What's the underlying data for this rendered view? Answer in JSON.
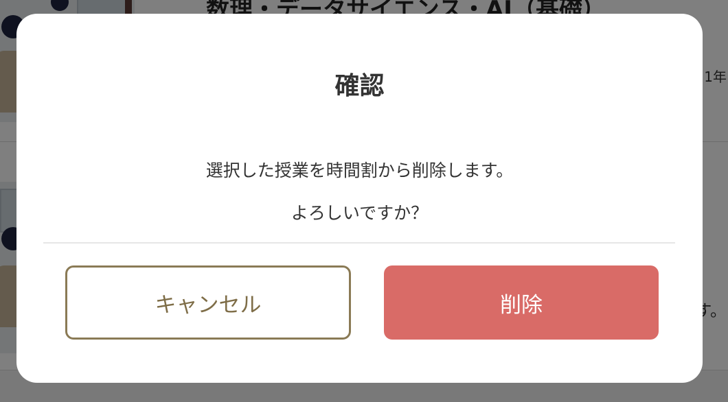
{
  "background": {
    "course_title": "数理・データサイエンス・AI（基礎）",
    "year_fragment": "1年",
    "description_fragment": "す。"
  },
  "dialog": {
    "title": "確認",
    "message_line1": "選択した授業を時間割から削除します。",
    "message_line2": "よろしいですか？",
    "cancel_label": "キャンセル",
    "delete_label": "削除"
  },
  "colors": {
    "overlay": "rgba(0,0,0,0.5)",
    "cancel_border": "#8a7a55",
    "cancel_text": "#7e6d47",
    "delete_background": "#d96b67",
    "delete_text": "#ffffff"
  }
}
